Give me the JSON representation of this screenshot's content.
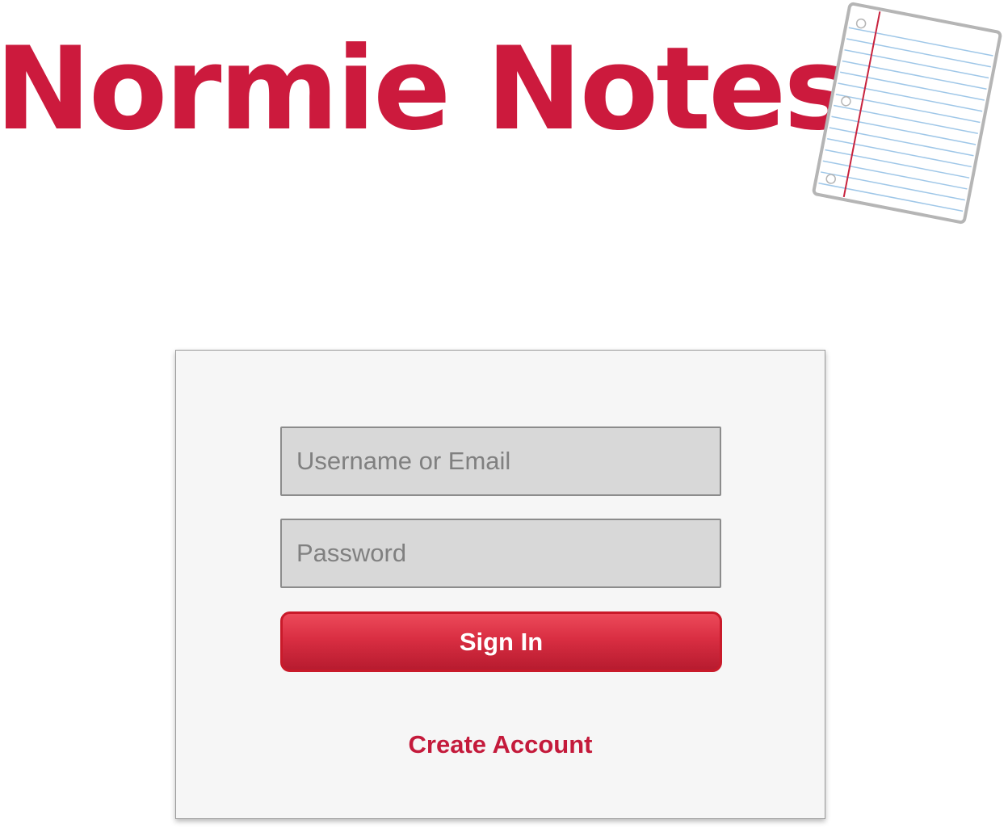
{
  "app": {
    "title": "Normie Notes",
    "logo_icon": "notebook-paper-icon"
  },
  "colors": {
    "brand": "#cc1a3d",
    "button_top": "#ec4a5a",
    "button_bottom": "#b71b2f",
    "card_background": "#f6f6f6",
    "field_background": "#d8d8d8"
  },
  "login": {
    "username_placeholder": "Username or Email",
    "username_value": "",
    "password_placeholder": "Password",
    "password_value": "",
    "sign_in_label": "Sign In",
    "create_account_label": "Create Account"
  }
}
